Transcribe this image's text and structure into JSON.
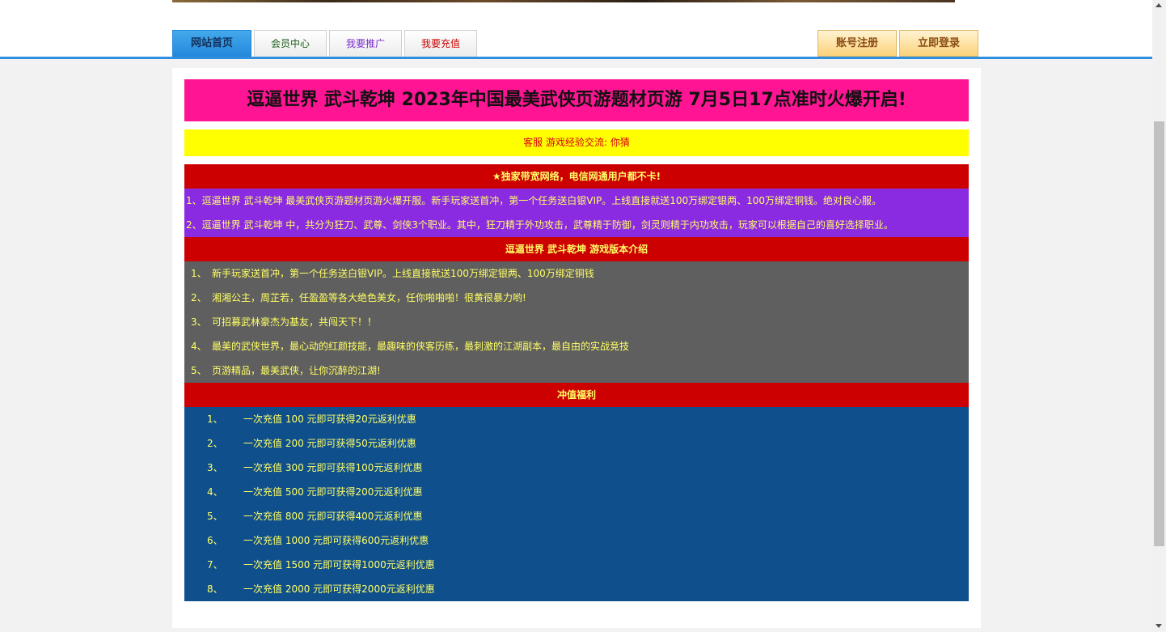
{
  "nav": {
    "tabs": [
      {
        "label": "网站首页",
        "color": "#12305a"
      },
      {
        "label": "会员中心",
        "color": "#1a5e1a"
      },
      {
        "label": "我要推广",
        "color": "#7b2fc9"
      },
      {
        "label": "我要充值",
        "color": "#cc0000"
      }
    ],
    "register_label": "账号注册",
    "login_label": "立即登录"
  },
  "headline": "逗逼世界 武斗乾坤 2023年中国最美武侠页游题材页游 7月5日17点准时火爆开启!",
  "contact": "客服 游戏经验交流: 你猜",
  "network_title": "★独家带宽网络，电信网通用户都不卡!",
  "intro": [
    "1、逗逼世界 武斗乾坤 最美武侠页游题材页游火爆开服。新手玩家送首冲，第一个任务送白银VIP。上线直接就送100万绑定银两、100万绑定铜钱。绝对良心服。",
    "2、逗逼世界 武斗乾坤 中，共分为狂刀、武尊、剑侠3个职业。其中，狂刀精于外功攻击，武尊精于防御，剑灵则精于内功攻击，玩家可以根据自己的喜好选择职业。"
  ],
  "version_title": "逗逼世界 武斗乾坤 游戏版本介绍",
  "features": [
    {
      "num": "1、",
      "text": "新手玩家送首冲，第一个任务送白银VIP。上线直接就送100万绑定银两、100万绑定铜钱"
    },
    {
      "num": "2、",
      "text": "湘湘公主，周芷若，任盈盈等各大绝色美女，任你啪啪啪！很黄很暴力哟!"
    },
    {
      "num": "3、",
      "text": "可招募武林豪杰为基友，共闯天下！！"
    },
    {
      "num": "4、",
      "text": "最美的武侠世界，最心动的红颜技能，最趣味的侠客历练，最刺激的江湖副本，最自由的实战竞技"
    },
    {
      "num": "5、",
      "text": "页游精品，最美武侠，让你沉醉的江湖!"
    }
  ],
  "recharge_title": "冲值福利",
  "recharge": [
    {
      "num": "1、",
      "text": "一次充值 100 元即可获得20元返利优惠"
    },
    {
      "num": "2、",
      "text": "一次充值 200 元即可获得50元返利优惠"
    },
    {
      "num": "3、",
      "text": "一次充值 300 元即可获得100元返利优惠"
    },
    {
      "num": "4、",
      "text": "一次充值 500 元即可获得200元返利优惠"
    },
    {
      "num": "5、",
      "text": "一次充值 800 元即可获得400元返利优惠"
    },
    {
      "num": "6、",
      "text": "一次充值 1000 元即可获得600元返利优惠"
    },
    {
      "num": "7、",
      "text": "一次充值 1500 元即可获得1000元返利优惠"
    },
    {
      "num": "8、",
      "text": "一次充值 2000 元即可获得2000元返利优惠"
    }
  ]
}
